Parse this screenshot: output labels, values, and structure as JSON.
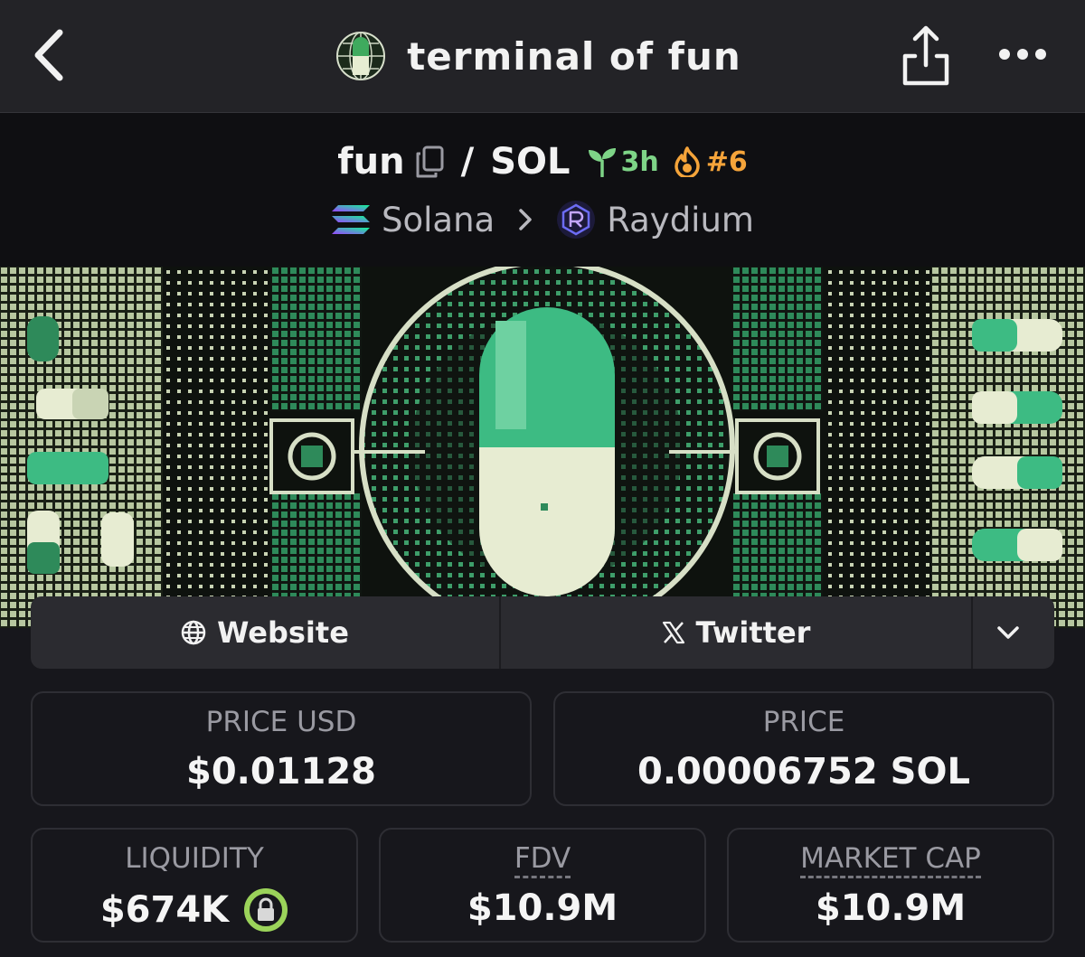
{
  "app": {
    "title": "terminal of fun"
  },
  "pair": {
    "base": "fun",
    "quote": "SOL",
    "age": "3h",
    "rank": "#6",
    "chain": "Solana",
    "dex": "Raydium"
  },
  "links": {
    "website_label": "Website",
    "twitter_label": "Twitter"
  },
  "stats": {
    "price_usd": {
      "label": "PRICE USD",
      "value": "$0.01128"
    },
    "price": {
      "label": "PRICE",
      "value": "0.00006752 SOL"
    },
    "liquidity": {
      "label": "LIQUIDITY",
      "value": "$674K"
    },
    "fdv": {
      "label": "FDV",
      "value": "$10.9M"
    },
    "market_cap": {
      "label": "MARKET CAP",
      "value": "$10.9M"
    }
  },
  "icons": {
    "back": "chevron-left-icon",
    "share": "share-icon",
    "more": "more-horizontal-icon",
    "copy": "copy-icon",
    "age": "sprout-icon",
    "rank": "flame-icon",
    "website": "globe-icon",
    "twitter": "x-logo-icon",
    "expand": "chevron-down-icon",
    "liquidity_lock": "lock-icon"
  },
  "colors": {
    "background": "#17171c",
    "navbar": "#232327",
    "age_green": "#7ed487",
    "rank_orange": "#f5a43a",
    "liquidity_lock_ring": "#9bd35a"
  }
}
